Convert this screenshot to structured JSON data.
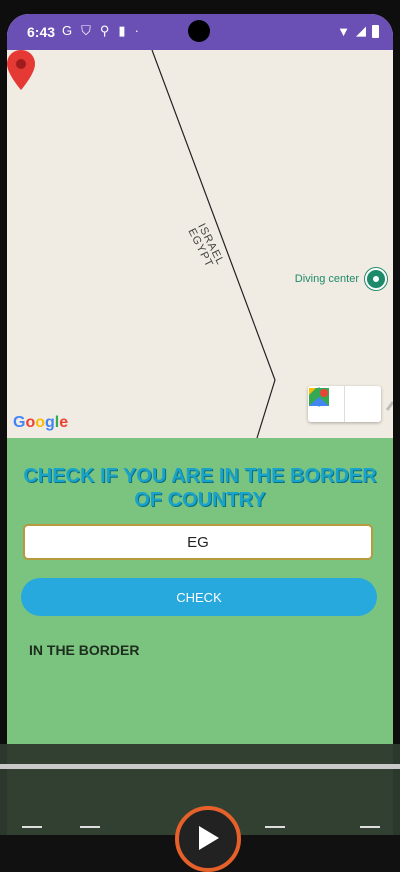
{
  "status_bar": {
    "time": "6:43",
    "icons_left": [
      "G",
      "shield-icon",
      "location-icon",
      "sd-card-icon",
      "dot-icon"
    ],
    "icons_right": [
      "wifi-icon",
      "signal-icon",
      "battery-icon"
    ]
  },
  "map": {
    "border_label_line1": "ISRAEL",
    "border_label_line2": "EGYPT",
    "poi_label": "Diving center",
    "google_logo": "Google",
    "buttons": [
      "directions-icon",
      "google-maps-icon"
    ],
    "colors": {
      "land": "#f1ece3",
      "pin": "#e53935",
      "poi": "#1d8a6a"
    }
  },
  "panel": {
    "title": "CHECK IF YOU ARE IN THE BORDER OF COUNTRY",
    "country_code_value": "EG",
    "check_button_label": "CHECK",
    "result_text": "IN THE BORDER",
    "colors": {
      "background": "#7bc47f",
      "title": "#1aa3c8",
      "button": "#27a9dd"
    }
  },
  "media_overlay": {
    "controls": [
      "prev-icon",
      "rewind-icon",
      "play-icon",
      "forward-icon",
      "next-icon"
    ]
  }
}
